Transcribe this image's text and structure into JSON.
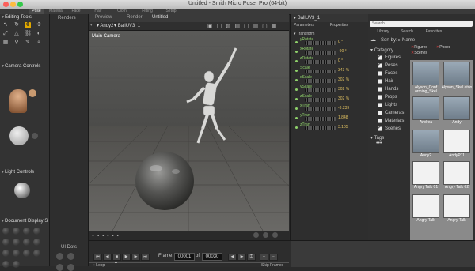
{
  "window": {
    "title": "Untitled - Smith Micro Poser Pro  (64-bit)"
  },
  "room_tabs": [
    "Pose",
    "Material",
    "Face",
    "Hair",
    "Cloth",
    "Fitting",
    "Setup"
  ],
  "left_panel": {
    "editing_tools": "Editing Tools",
    "camera_controls": "Camera Controls",
    "light_controls": "Light Controls",
    "document_display": "Document Display S",
    "ui_dots": "UI Dots",
    "renders": "Renders"
  },
  "viewport": {
    "tabs": [
      "Preview",
      "Render",
      "Untitled"
    ],
    "figure_menu": "Andy2",
    "actor_menu": "BallUV3_1",
    "camera_label": "Main Camera"
  },
  "params": {
    "title": "BallUV3_1",
    "tabs": [
      "Parameters",
      "Properties"
    ],
    "group": "Transform",
    "rows": [
      {
        "name": "yRotate",
        "value": "0 °"
      },
      {
        "name": "xRotate",
        "value": "-90 °"
      },
      {
        "name": "zRotate",
        "value": "0 °"
      },
      {
        "name": "Scale",
        "value": "343 %"
      },
      {
        "name": "xScale",
        "value": "302 %"
      },
      {
        "name": "yScale",
        "value": "302 %"
      },
      {
        "name": "zScale",
        "value": "302 %"
      },
      {
        "name": "xTran",
        "value": "-3.239"
      },
      {
        "name": "yTran",
        "value": "1.848"
      },
      {
        "name": "zTran",
        "value": "3.105"
      }
    ]
  },
  "library": {
    "search_placeholder": "Search",
    "tabs": [
      "Library",
      "Search",
      "Favorites"
    ],
    "sort_by": "Sort by:",
    "sort_value": "Name",
    "filters": [
      "Figures",
      "Poses",
      "Scenes"
    ],
    "category_title": "Category",
    "categories": [
      {
        "label": "Figures",
        "checked": true
      },
      {
        "label": "Poses",
        "checked": true
      },
      {
        "label": "Faces",
        "checked": false
      },
      {
        "label": "Hair",
        "checked": false
      },
      {
        "label": "Hands",
        "checked": false
      },
      {
        "label": "Props",
        "checked": false
      },
      {
        "label": "Lights",
        "checked": false
      },
      {
        "label": "Cameras",
        "checked": false
      },
      {
        "label": "Materials",
        "checked": false
      },
      {
        "label": "Scenes",
        "checked": true
      }
    ],
    "tags_title": "Tags",
    "thumbnails": [
      "Alyson_Conf orming_Skel",
      "Alyson_Skel eton",
      "Andrea",
      "Andy",
      "Andy2",
      "AndyP11",
      "Angry Talk 01",
      "Angry Talk 02",
      "Angry Talk",
      "Angry Talk"
    ]
  },
  "animation": {
    "frame_label": "Frame:",
    "frame_current": "00001",
    "frame_of": "of",
    "frame_total": "00030",
    "loop_label": "Loop",
    "skip_frames_label": "Skip Frames"
  },
  "colors": {
    "accent": "#e0a800",
    "param_label": "#8fd16a",
    "param_value": "#e0c060"
  }
}
